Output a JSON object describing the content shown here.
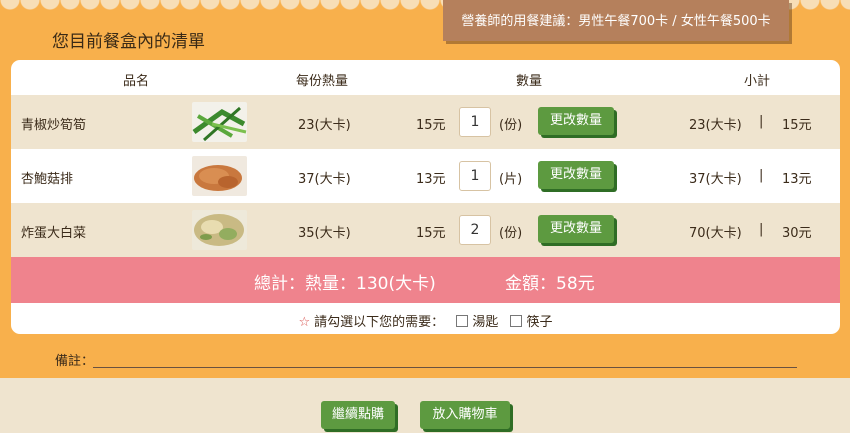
{
  "title": "您目前餐盒內的清單",
  "advice": "營養師的用餐建議：男性午餐700卡 / 女性午餐500卡",
  "headers": {
    "name": "品名",
    "calories": "每份熱量",
    "quantity": "數量",
    "subtotal": "小計"
  },
  "items": [
    {
      "name": "青椒炒筍筍",
      "calories": "23(大卡)",
      "price": "15元",
      "qty": "1",
      "unit": "(份)",
      "button": "更改數量",
      "sub_cal": "23(大卡)",
      "sep": "|",
      "sub_price": "15元"
    },
    {
      "name": "杏鮑菇排",
      "calories": "37(大卡)",
      "price": "13元",
      "qty": "1",
      "unit": "(片)",
      "button": "更改數量",
      "sub_cal": "37(大卡)",
      "sep": "|",
      "sub_price": "13元"
    },
    {
      "name": "炸蛋大白菜",
      "calories": "35(大卡)",
      "price": "15元",
      "qty": "2",
      "unit": "(份)",
      "button": "更改數量",
      "sub_cal": "70(大卡)",
      "sep": "|",
      "sub_price": "30元"
    }
  ],
  "total": {
    "calories": "總計：熱量：130(大卡)",
    "amount": "金額：58元"
  },
  "needs": {
    "star": "☆",
    "prompt": "請勾選以下您的需要：",
    "options": [
      "湯匙",
      "筷子"
    ]
  },
  "note_label": "備註：",
  "buttons": {
    "continue": "繼續點購",
    "add_to_cart": "放入購物車"
  }
}
